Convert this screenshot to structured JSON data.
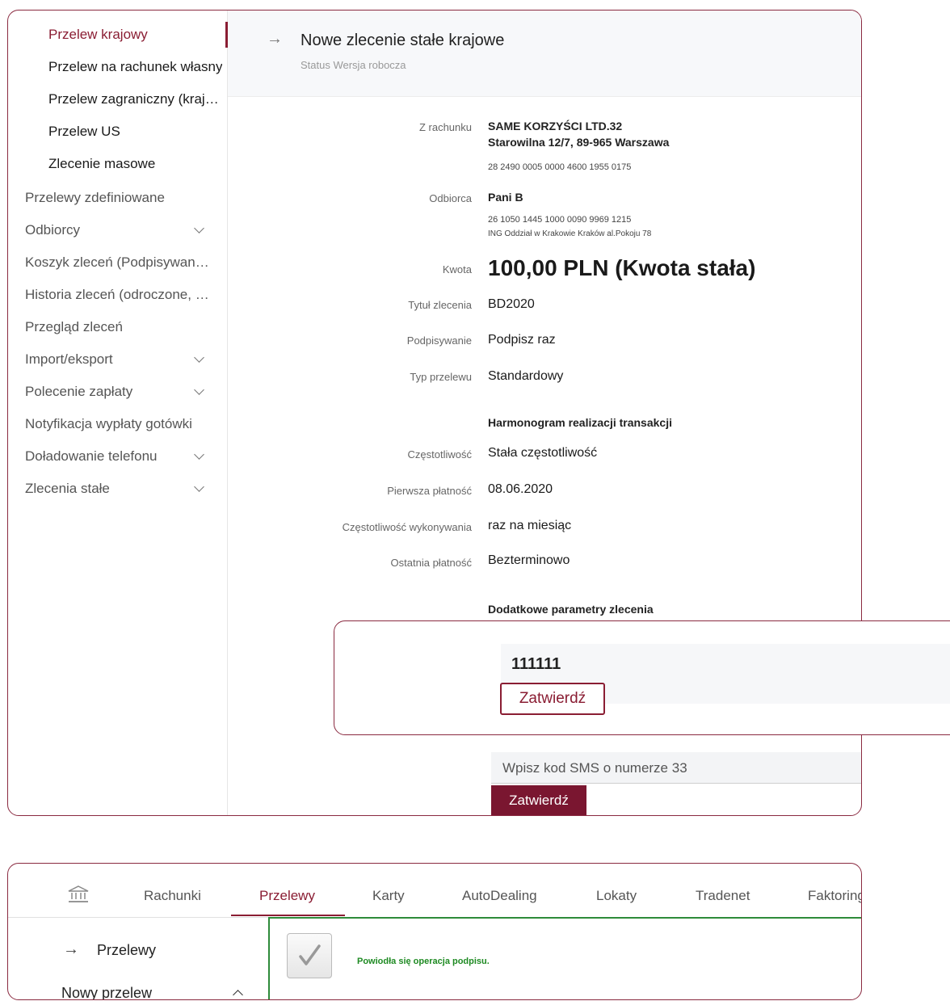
{
  "sidebar": {
    "items": [
      {
        "label": "Przelew krajowy"
      },
      {
        "label": "Przelew na rachunek własny"
      },
      {
        "label": "Przelew zagraniczny (krajowy)"
      },
      {
        "label": "Przelew US"
      },
      {
        "label": "Zlecenie masowe"
      },
      {
        "label": "Przelewy zdefiniowane"
      },
      {
        "label": "Odbiorcy"
      },
      {
        "label": "Koszyk zleceń (Podpisywanie)"
      },
      {
        "label": "Historia zleceń (odroczone, ...)"
      },
      {
        "label": "Przegląd zleceń"
      },
      {
        "label": "Import/eksport"
      },
      {
        "label": "Polecenie zapłaty"
      },
      {
        "label": "Notyfikacja wypłaty gotówki"
      },
      {
        "label": "Doładowanie telefonu"
      },
      {
        "label": "Zlecenia stałe"
      }
    ]
  },
  "header": {
    "title": "Nowe zlecenie stałe krajowe",
    "status": "Status Wersja robocza"
  },
  "details": {
    "from_label": "Z rachunku",
    "from_name": "SAME KORZYŚCI LTD.32",
    "from_address": "Starowilna 12/7, 89-965 Warszawa",
    "from_account": "28 2490 0005 0000 4600 1955 0175",
    "recipient_label": "Odbiorca",
    "recipient_name": "Pani B",
    "recipient_account": "26 1050 1445 1000 0090 9969 1215",
    "recipient_bank": "ING Oddział w Krakowie Kraków al.Pokoju 78",
    "amount_label": "Kwota",
    "amount_value": "100,00 PLN (Kwota stała)",
    "title_label": "Tytuł zlecenia",
    "title_value": "BD2020",
    "signing_label": "Podpisywanie",
    "signing_value": "Podpisz raz",
    "type_label": "Typ przelewu",
    "type_value": "Standardowy",
    "schedule_title": "Harmonogram realizacji transakcji",
    "freq_label": "Częstotliwość",
    "freq_value": "Stała częstotliwość",
    "first_label": "Pierwsza płatność",
    "first_value": "08.06.2020",
    "exec_label": "Częstotliwość wykonywania",
    "exec_value": "raz na miesiąc",
    "last_label": "Ostatnia płatność",
    "last_value": "Bezterminowo",
    "extra_title": "Dodatkowe parametry zlecenia"
  },
  "sms": {
    "placeholder": "Wpisz kod SMS o numerze 33",
    "confirm_label": "Zatwierdź"
  },
  "overlay": {
    "code_value": "111111",
    "confirm_label": "Zatwierdź"
  },
  "bottom": {
    "nav": [
      "Rachunki",
      "Przelewy",
      "Karty",
      "AutoDealing",
      "Lokaty",
      "Tradenet",
      "Faktoring"
    ],
    "side_przelewy": "Przelewy",
    "side_nowy": "Nowy przelew",
    "success_message": "Powiodła się operacja podpisu."
  },
  "colors": {
    "brand": "#8a1d33",
    "success": "#1e8a22"
  }
}
